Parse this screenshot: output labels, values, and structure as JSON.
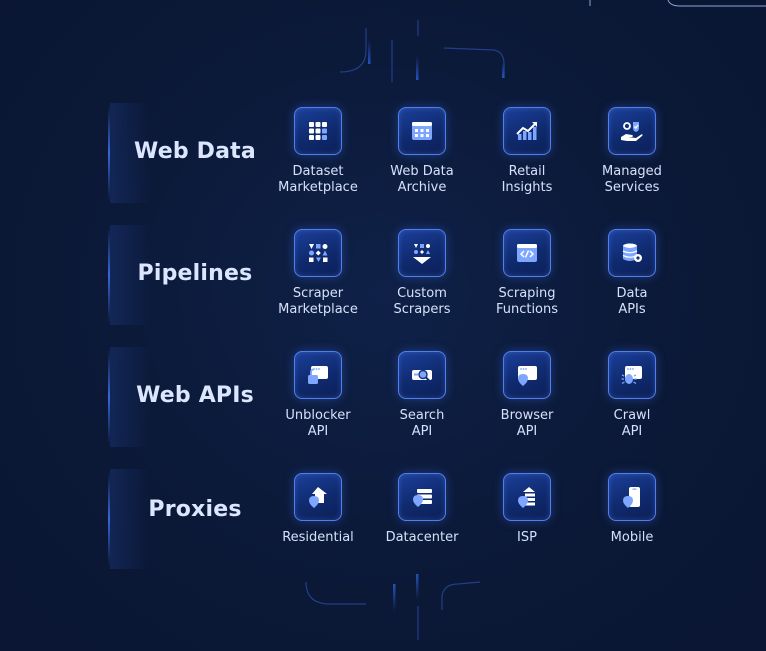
{
  "sections": [
    {
      "title": "Web Data",
      "items": [
        {
          "label": "Dataset\nMarketplace",
          "icon": "grid-dataset-icon"
        },
        {
          "label": "Web Data\nArchive",
          "icon": "archive-calendar-icon"
        },
        {
          "label": "Retail\nInsights",
          "icon": "rising-chart-icon"
        },
        {
          "label": "Managed\nServices",
          "icon": "hand-gear-shield-icon"
        }
      ]
    },
    {
      "title": "Pipelines",
      "items": [
        {
          "label": "Scraper\nMarketplace",
          "icon": "shapes-grid-icon"
        },
        {
          "label": "Custom\nScrapers",
          "icon": "shapes-funnel-icon"
        },
        {
          "label": "Scraping\nFunctions",
          "icon": "code-window-icon"
        },
        {
          "label": "Data\nAPIs",
          "icon": "database-gear-icon"
        }
      ]
    },
    {
      "title": "Web APIs",
      "items": [
        {
          "label": "Unblocker\nAPI",
          "icon": "unlock-window-icon"
        },
        {
          "label": "Search\nAPI",
          "icon": "search-window-icon"
        },
        {
          "label": "Browser\nAPI",
          "icon": "browser-pin-icon"
        },
        {
          "label": "Crawl\nAPI",
          "icon": "bug-window-icon"
        }
      ]
    },
    {
      "title": "Proxies",
      "items": [
        {
          "label": "Residential",
          "icon": "house-pin-icon"
        },
        {
          "label": "Datacenter",
          "icon": "server-pin-icon"
        },
        {
          "label": "ISP",
          "icon": "tower-pin-icon"
        },
        {
          "label": "Mobile",
          "icon": "phone-pin-icon"
        }
      ]
    }
  ],
  "colors": {
    "background": "#0b1836",
    "tile_border": "#4d7ff0",
    "tile_fill": "#12307c",
    "icon_primary": "#7fa6ff",
    "icon_secondary": "#ffffff",
    "title_text": "#dce6ff"
  }
}
